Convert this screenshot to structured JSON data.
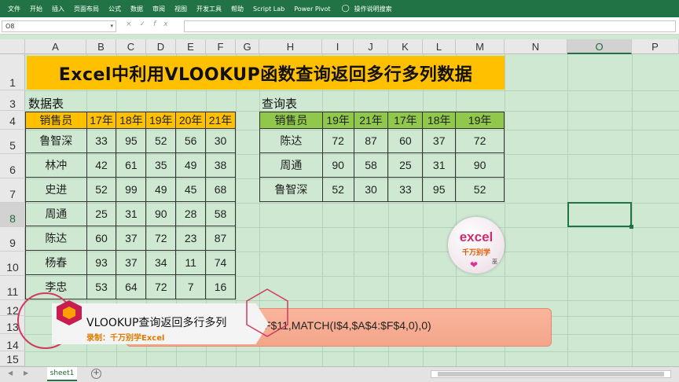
{
  "ribbon": {
    "tabs": [
      "文件",
      "开始",
      "插入",
      "页面布局",
      "公式",
      "数据",
      "审阅",
      "视图",
      "开发工具",
      "帮助",
      "Script Lab",
      "Power Pivot"
    ],
    "search": "操作说明搜索",
    "color": "#217346"
  },
  "formula_bar": {
    "name_box": "O8",
    "formula": ""
  },
  "columns": [
    "A",
    "B",
    "C",
    "D",
    "E",
    "F",
    "G",
    "H",
    "I",
    "J",
    "K",
    "L",
    "M",
    "N",
    "O",
    "P"
  ],
  "rows": [
    "1",
    "3",
    "4",
    "5",
    "6",
    "7",
    "8",
    "9",
    "10",
    "11",
    "12",
    "13",
    "14",
    "15"
  ],
  "selected_cell": "O8",
  "sheet": {
    "title": "Excel中利用VLOOKUP函数查询返回多行多列数据",
    "data_label": "数据表",
    "query_label": "查询表",
    "data_table": {
      "headers": [
        "销售员",
        "17年",
        "18年",
        "19年",
        "20年",
        "21年"
      ],
      "rows": [
        [
          "鲁智深",
          "33",
          "95",
          "52",
          "56",
          "30"
        ],
        [
          "林冲",
          "42",
          "61",
          "35",
          "49",
          "38"
        ],
        [
          "史进",
          "52",
          "99",
          "49",
          "45",
          "68"
        ],
        [
          "周通",
          "25",
          "31",
          "90",
          "28",
          "58"
        ],
        [
          "陈达",
          "60",
          "37",
          "72",
          "23",
          "87"
        ],
        [
          "杨春",
          "93",
          "37",
          "34",
          "11",
          "74"
        ],
        [
          "李忠",
          "53",
          "64",
          "72",
          "7",
          "16"
        ]
      ],
      "header_color": "#ffc000"
    },
    "query_table": {
      "headers": [
        "销售员",
        "19年",
        "21年",
        "17年",
        "18年",
        "19年"
      ],
      "rows": [
        [
          "陈达",
          "72",
          "87",
          "60",
          "37",
          "72"
        ],
        [
          "周通",
          "90",
          "58",
          "25",
          "31",
          "90"
        ],
        [
          "鲁智深",
          "52",
          "30",
          "33",
          "95",
          "52"
        ]
      ],
      "header_color": "#8fc84b"
    },
    "formula_banner": "F$11,MATCH(I$4,$A$4:$F$4,0),0)"
  },
  "overlay": {
    "caption_title": "VLOOKUP查询返回多行多列",
    "caption_sub": "录制：千万别学Excel"
  },
  "logo": {
    "word": "excel",
    "sub": "千万别学",
    "tag": "巫"
  },
  "tabs": {
    "sheet_name": "sheet1",
    "add_symbol": "+"
  },
  "icons": {
    "bulb": "lightbulb-icon",
    "add": "plus-circle-icon",
    "heart": "heart-icon"
  }
}
